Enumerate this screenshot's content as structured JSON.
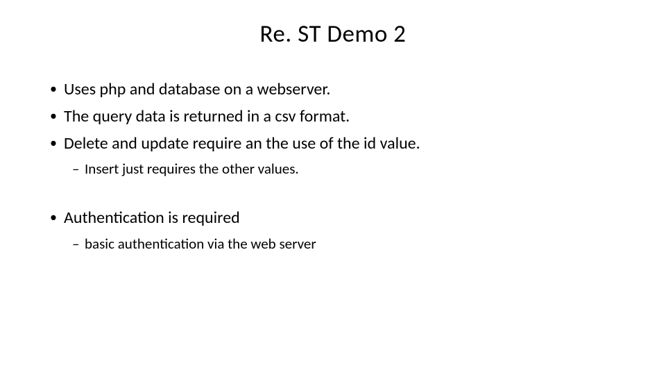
{
  "slide": {
    "title": "Re. ST Demo 2",
    "bullets": [
      {
        "level": 1,
        "text": "Uses php and database on a webserver."
      },
      {
        "level": 1,
        "text": "The query data is returned in a csv format."
      },
      {
        "level": 1,
        "text": "Delete and update require an the use of the id value."
      },
      {
        "level": 2,
        "text": "Insert just requires the other values."
      },
      {
        "level": 0,
        "text": ""
      },
      {
        "level": 1,
        "text": "Authentication is required"
      },
      {
        "level": 2,
        "text": "basic authentication via the web server"
      }
    ]
  }
}
